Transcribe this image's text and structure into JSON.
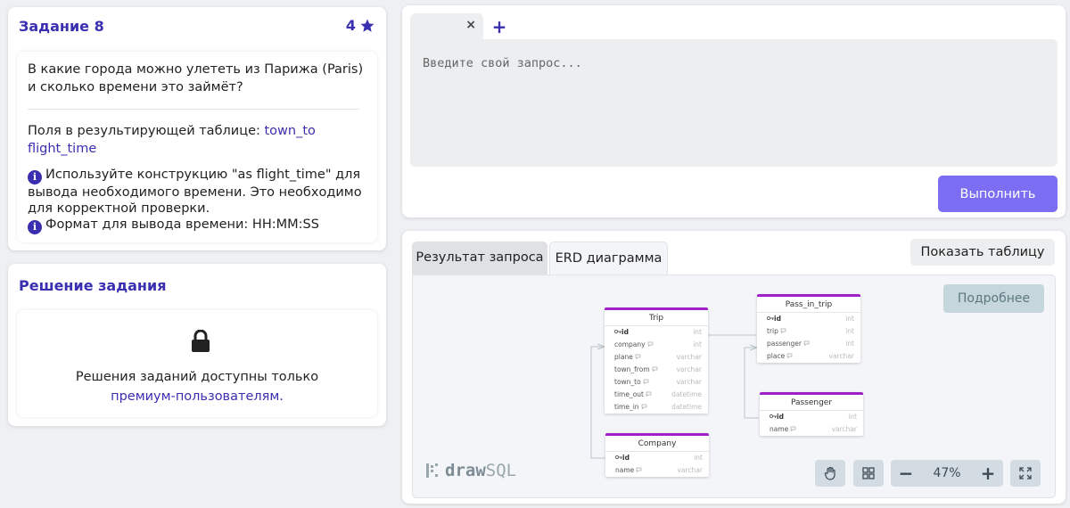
{
  "task": {
    "title": "Задание 8",
    "points": "4",
    "question": "В какие города можно улететь из Парижа (Paris) и сколько времени это займёт?",
    "fields_label": "Поля в результирующей таблице:",
    "fields": [
      "town_to",
      "flight_time"
    ],
    "hints": [
      "Используйте конструкцию \"as flight_time\" для вывода необходимого времени. Это необходимо для корректной проверки.",
      "Формат для вывода времени: HH:MM:SS"
    ]
  },
  "solution": {
    "title": "Решение задания",
    "text": "Решения заданий доступны только",
    "link": "премиум-пользователям."
  },
  "query": {
    "tab_close": "×",
    "add_tab": "+",
    "placeholder": "Введите свой запрос...",
    "run_label": "Выполнить"
  },
  "result": {
    "tabs": [
      "Результат запроса",
      "ERD диаграмма"
    ],
    "active_tab": "ERD диаграмма",
    "show_table_label": "Показать таблицу",
    "more_label": "Подробнее",
    "zoom_level": "47%",
    "zoom_minus": "−",
    "zoom_plus": "+",
    "logo_draw": "draw",
    "logo_sql": "SQL"
  },
  "erd": {
    "tables": [
      {
        "name": "Trip",
        "columns": [
          {
            "name": "id",
            "type": "int",
            "pk": true
          },
          {
            "name": "company",
            "type": "int"
          },
          {
            "name": "plane",
            "type": "varchar"
          },
          {
            "name": "town_from",
            "type": "varchar"
          },
          {
            "name": "town_to",
            "type": "varchar"
          },
          {
            "name": "time_out",
            "type": "datetime"
          },
          {
            "name": "time_in",
            "type": "datetime"
          }
        ]
      },
      {
        "name": "Pass_in_trip",
        "columns": [
          {
            "name": "id",
            "type": "int",
            "pk": true
          },
          {
            "name": "trip",
            "type": "int"
          },
          {
            "name": "passenger",
            "type": "int"
          },
          {
            "name": "place",
            "type": "varchar"
          }
        ]
      },
      {
        "name": "Passenger",
        "columns": [
          {
            "name": "id",
            "type": "int",
            "pk": true
          },
          {
            "name": "name",
            "type": "varchar"
          }
        ]
      },
      {
        "name": "Company",
        "columns": [
          {
            "name": "id",
            "type": "int",
            "pk": true
          },
          {
            "name": "name",
            "type": "varchar"
          }
        ]
      }
    ]
  },
  "colors": {
    "accent": "#3a2fb0",
    "run_button": "#7b6ef2",
    "erd_table_header": "#a020c8"
  },
  "icons": [
    "star-icon",
    "info-icon",
    "lock-icon",
    "close-icon",
    "plus-icon",
    "hand-icon",
    "grid-icon",
    "minus-icon",
    "zoom-plus-icon",
    "fullscreen-icon",
    "key-icon",
    "comment-icon"
  ]
}
